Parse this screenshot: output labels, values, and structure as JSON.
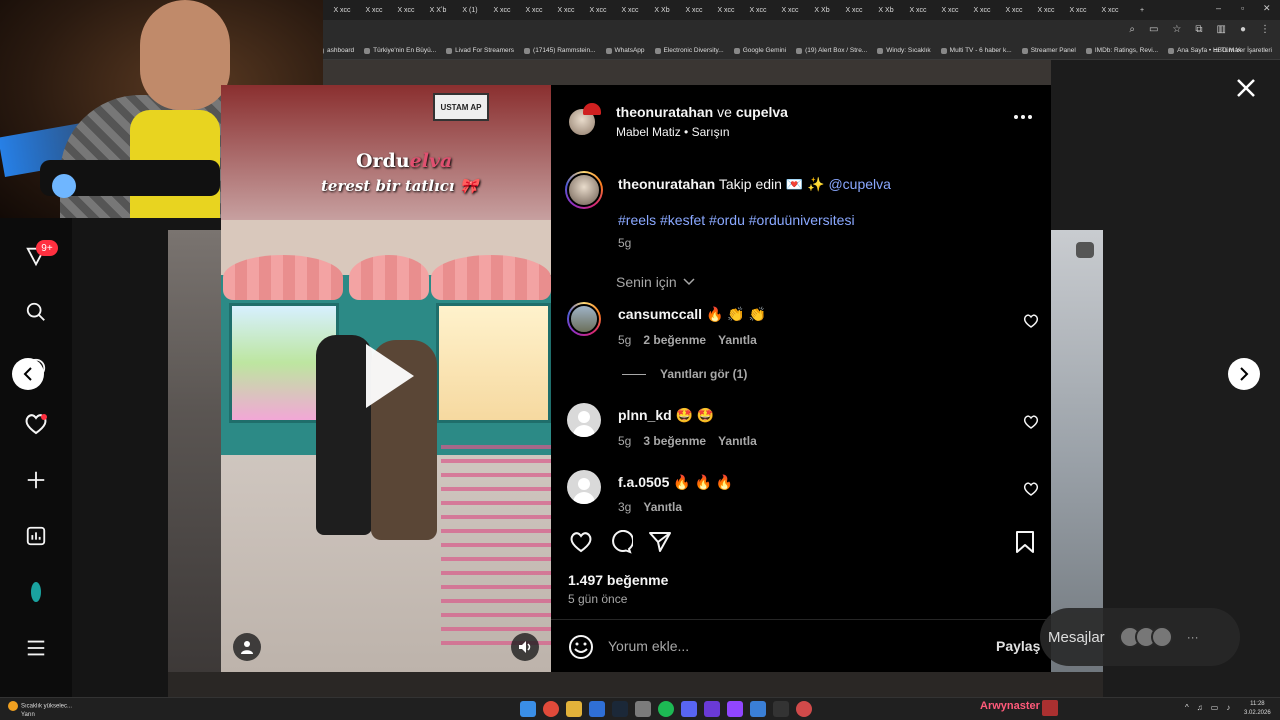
{
  "browser": {
    "tab_labels": [
      "X xcc",
      "X xcc",
      "X xcc",
      "X Xʼb",
      "X (1)",
      "X xcc",
      "X xcc",
      "X xcc",
      "X xcc",
      "X xcc",
      "X Xb",
      "X xcc",
      "X xcc",
      "X xcc",
      "X xcc",
      "X Xb",
      "X xcc",
      "X Xb",
      "X xcc",
      "X xcc",
      "X xcc",
      "X xcc",
      "X xcc",
      "X xcc",
      "X xcc"
    ],
    "new_tab": "+",
    "bookmarks": [
      "ashboard",
      "Türkiye'nin En Büyü...",
      "Livad For Streamers",
      "(17145) Rammstein...",
      "WhatsApp",
      "Electronic Diversity...",
      "Google Gemini",
      "(19) Alert Box / Stre...",
      "Windy: Sıcaklık",
      "Multi TV - 6 haber k...",
      "Streamer Panel",
      "IMDb: Ratings, Revi...",
      "Ana Sayfa • HBO Max"
    ],
    "bookmarks_right": "Tüm Yer İşaretleri"
  },
  "video": {
    "sign_text": "USTAM AP",
    "overlay_title": "Ordu",
    "overlay_brand": "elva",
    "overlay_line": "terest bir tatlıcı 🎀"
  },
  "post": {
    "header_user1": "theonuratahan",
    "header_and": "ve",
    "header_user2": "cupelva",
    "header_audio": "Mabel Matiz",
    "header_sep": "•",
    "header_song": "Sarışın",
    "caption_user": "theonuratahan",
    "caption_text": "Takip edin 💌 ✨",
    "caption_mention": "@cupelva",
    "hashtags": "#reels #kesfet #ordu #orduüniversitesi",
    "caption_time": "5g",
    "sort_label": "Senin için",
    "see_replies": "Yanıtları gör (1)",
    "likes": "1.497 beğenme",
    "posted_ago": "5 gün önce",
    "comment_placeholder": "Yorum ekle...",
    "share_label": "Paylaş"
  },
  "comments": [
    {
      "user": "cansumccall",
      "emoji": "🔥 👏 👏",
      "time": "5g",
      "likes": "2 beğenme",
      "reply": "Yanıtla"
    },
    {
      "user": "plnn_kd",
      "emoji": "🤩 🤩",
      "time": "5g",
      "likes": "3 beğenme",
      "reply": "Yanıtla"
    },
    {
      "user": "f.a.0505",
      "emoji": "🔥 🔥 🔥",
      "time": "3g",
      "likes": "",
      "reply": "Yanıtla"
    }
  ],
  "left_nav": {
    "badge": "9+"
  },
  "messages": {
    "label": "Mesajlar"
  },
  "taskbar": {
    "weather_line1": "Sıcaklık yükselec...",
    "weather_line2": "Yarın",
    "streamer_name": "Arwynaster",
    "time": "11:28",
    "date": "3.02.2026"
  },
  "colors": {
    "accent_link": "#8aa8ff",
    "notification": "#ff3040",
    "panel_bg": "#000000"
  }
}
